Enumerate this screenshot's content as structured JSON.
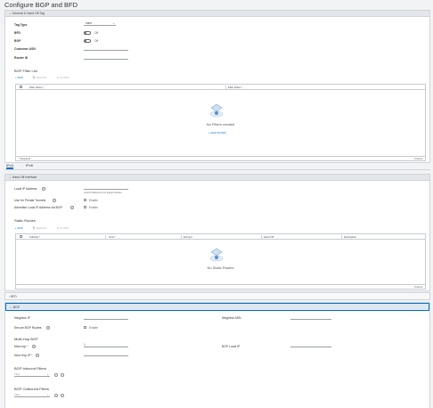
{
  "page_title": "Configure BGP and BFD",
  "general": {
    "section_title": "General & Hand Off Tag",
    "tag_type_label": "Tag Type",
    "tag_type_value": "none",
    "bfd_label": "BFD",
    "bfd_value": "Off",
    "bgp_label": "BGP",
    "bgp_value": "Off",
    "customer_asn_label": "Customer ASN",
    "router_id_label": "Router ID",
    "filter_list_title": "BGP Filter List",
    "add": "ADD",
    "delete": "DELETE",
    "clone": "CLONE",
    "col_filter_name": "Filter Name *",
    "col_filter_rules": "Filter Rules *",
    "empty_text": "No Filters created",
    "empty_action": "ADD FILTER",
    "footer_left": "* Required",
    "footer_right": "0 items"
  },
  "tabs": [
    "IPv4",
    "IPv6"
  ],
  "handoff": {
    "section_title": "Hand Off Interface",
    "local_ip_label": "Local IP Address",
    "local_ip_hint": "Local IP Address for the logical interface",
    "private_tunnel_label": "Use for Private Tunnels",
    "advertise_label": "Advertise Local IP Address via BGP",
    "enable": "Enable",
    "static_routes_title": "Static Routes",
    "add": "ADD",
    "delete": "DELETE",
    "clone": "CLONE",
    "col_subnets": "Subnets *",
    "col_cost": "Cost *",
    "col_encrypt": "Encrypt",
    "col_handoff": "Hand Off",
    "col_description": "Description",
    "empty_text": "No Static Routes",
    "footer_right": "0 items"
  },
  "bfd_section": "BFD",
  "bgp_section": {
    "title": "BGP",
    "neighbor_ip_label": "Neighbor IP",
    "neighbor_asn_label": "Neighbor ASN",
    "secure_bgp_label": "Secure BGP Routes",
    "enable": "Enable",
    "multihop_title": "Multi-Hop BGP",
    "max_hop_label": "Max-hop *",
    "max_hop_value": "1",
    "bgp_local_ip_label": "BGP Local IP",
    "next_hop_label": "Next Hop IP *",
    "inbound_title": "BGP Inbound Filters",
    "outbound_title": "BGP Outbound Filters",
    "filter_placeholder": "Filter"
  }
}
